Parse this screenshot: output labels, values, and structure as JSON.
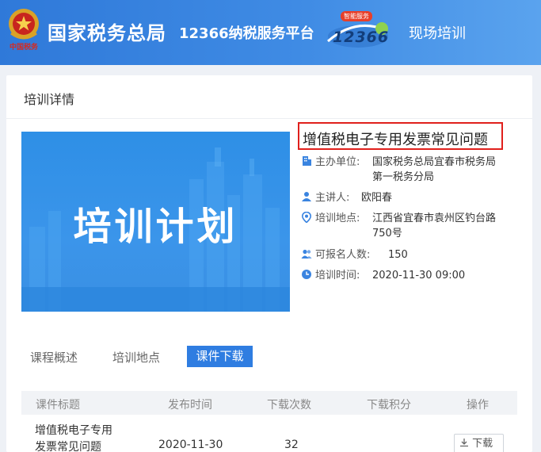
{
  "header": {
    "org_name": "国家税务总局",
    "platform_name": "12366纳税服务平台",
    "section_name": "现场培训",
    "emblem_caption": "中国税务",
    "logo_badge": "智能服务",
    "logo_digits": "12366"
  },
  "card": {
    "title": "培训详情"
  },
  "banner": {
    "text": "培训计划"
  },
  "course": {
    "title": "增值税电子专用发票常见问题",
    "organizer_label": "主办单位:",
    "organizer_line1": "国家税务总局宜春市税务局",
    "organizer_line2": "第一税务分局",
    "speaker_label": "主讲人:",
    "speaker": "欧阳春",
    "location_label": "培训地点:",
    "location_line1": "江西省宜春市袁州区钓台路",
    "location_line2": "750号",
    "capacity_label": "可报名人数:",
    "capacity": "150",
    "time_label": "培训时间:",
    "time": "2020-11-30 09:00"
  },
  "tabs": [
    "课程概述",
    "培训地点",
    "课件下载"
  ],
  "table": {
    "headers": [
      "课件标题",
      "发布时间",
      "下载次数",
      "下载积分",
      "操作"
    ],
    "rows": [
      {
        "title_line1": "增值税电子专用",
        "title_line2": "发票常见问题",
        "date": "2020-11-30",
        "downloads": "32",
        "points": "",
        "action": "下载"
      }
    ]
  },
  "colors": {
    "header_blue": "#3a84e0",
    "accent_blue": "#2f7de1",
    "highlight_red": "#e0201c"
  }
}
